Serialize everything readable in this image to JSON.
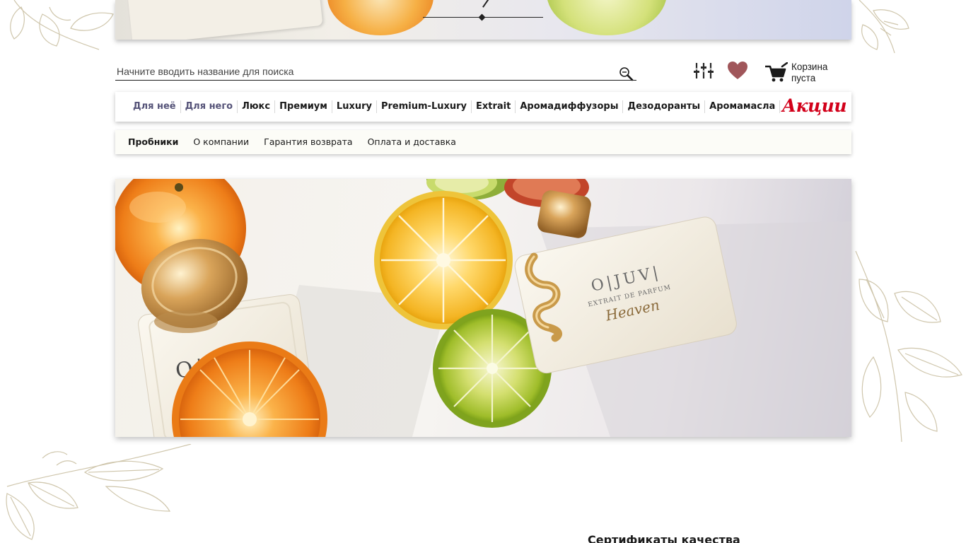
{
  "search": {
    "placeholder": "Начните вводить название для поиска"
  },
  "header": {
    "cart_label": "Корзина пуста"
  },
  "nav": {
    "items": [
      {
        "label": "Для неё",
        "accent": true
      },
      {
        "label": "Для него",
        "accent": true
      },
      {
        "label": "Люкс",
        "accent": false
      },
      {
        "label": "Премиум",
        "accent": false
      },
      {
        "label": "Luxury",
        "accent": false
      },
      {
        "label": "Premium-Luxury",
        "accent": false
      },
      {
        "label": "Extrait",
        "accent": false
      },
      {
        "label": "Аромадиффузоры",
        "accent": false
      },
      {
        "label": "Дезодоранты",
        "accent": false
      },
      {
        "label": "Аромамасла",
        "accent": false
      }
    ],
    "promo_label": "Акции"
  },
  "subnav": {
    "items": [
      {
        "label": "Пробники",
        "bold": true
      },
      {
        "label": "О компании",
        "bold": false
      },
      {
        "label": "Гарантия возврата",
        "bold": false
      },
      {
        "label": "Оплата и доставка",
        "bold": false
      }
    ]
  },
  "hero": {
    "bottle_brand": "O|JUV|",
    "bottle_subtitle": "EXTRAIT DE PARFUM",
    "bottle_name": "Heaven"
  },
  "sections": {
    "certificates_heading": "Сертификаты качества"
  },
  "colors": {
    "nav_accent": "#555378",
    "promo": "#d2001a",
    "heart": "#a0565a",
    "botanical": "#cfc6ac"
  },
  "icons": [
    "search-icon",
    "filter-icon",
    "heart-icon",
    "cart-icon"
  ]
}
